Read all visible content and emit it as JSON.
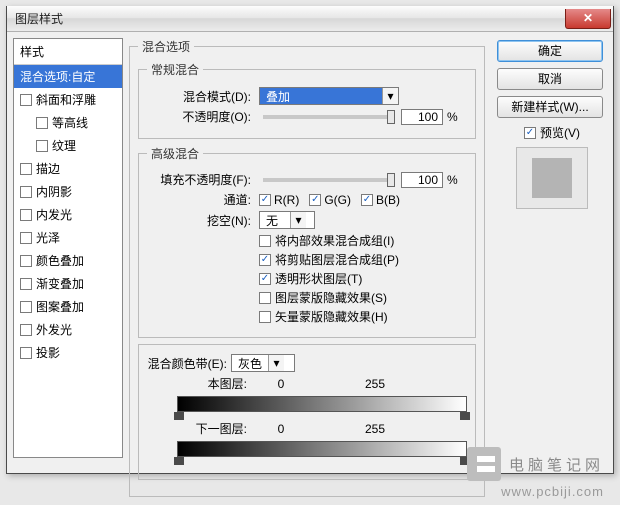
{
  "dialog": {
    "title": "图层样式"
  },
  "styles": {
    "header": "样式",
    "items": [
      {
        "label": "混合选项:自定",
        "selected": true,
        "indent": false,
        "cb": false
      },
      {
        "label": "斜面和浮雕",
        "indent": false,
        "cb": true
      },
      {
        "label": "等高线",
        "indent": true,
        "cb": true
      },
      {
        "label": "纹理",
        "indent": true,
        "cb": true
      },
      {
        "label": "描边",
        "indent": false,
        "cb": true
      },
      {
        "label": "内阴影",
        "indent": false,
        "cb": true
      },
      {
        "label": "内发光",
        "indent": false,
        "cb": true
      },
      {
        "label": "光泽",
        "indent": false,
        "cb": true
      },
      {
        "label": "颜色叠加",
        "indent": false,
        "cb": true
      },
      {
        "label": "渐变叠加",
        "indent": false,
        "cb": true
      },
      {
        "label": "图案叠加",
        "indent": false,
        "cb": true
      },
      {
        "label": "外发光",
        "indent": false,
        "cb": true
      },
      {
        "label": "投影",
        "indent": false,
        "cb": true
      }
    ]
  },
  "blend_options": {
    "group_title": "混合选项",
    "general": {
      "title": "常规混合",
      "mode_label": "混合模式(D):",
      "mode_value": "叠加",
      "opacity_label": "不透明度(O):",
      "opacity_value": "100",
      "opacity_unit": "%"
    },
    "advanced": {
      "title": "高级混合",
      "fill_label": "填充不透明度(F):",
      "fill_value": "100",
      "fill_unit": "%",
      "channel_label": "通道:",
      "channels": [
        {
          "label": "R(R)",
          "checked": true
        },
        {
          "label": "G(G)",
          "checked": true
        },
        {
          "label": "B(B)",
          "checked": true
        }
      ],
      "knockout_label": "挖空(N):",
      "knockout_value": "无",
      "options": [
        {
          "label": "将内部效果混合成组(I)",
          "checked": false
        },
        {
          "label": "将剪贴图层混合成组(P)",
          "checked": true
        },
        {
          "label": "透明形状图层(T)",
          "checked": true
        },
        {
          "label": "图层蒙版隐藏效果(S)",
          "checked": false
        },
        {
          "label": "矢量蒙版隐藏效果(H)",
          "checked": false
        }
      ]
    },
    "blendif": {
      "title_label": "混合颜色带(E):",
      "channel_value": "灰色",
      "this_label": "本图层:",
      "this_low": "0",
      "this_high": "255",
      "under_label": "下一图层:",
      "under_low": "0",
      "under_high": "255"
    }
  },
  "buttons": {
    "ok": "确定",
    "cancel": "取消",
    "newstyle": "新建样式(W)...",
    "preview_label": "预览(V)"
  },
  "watermark": {
    "text": "电脑笔记网",
    "url": "www.pcbiji.com"
  }
}
